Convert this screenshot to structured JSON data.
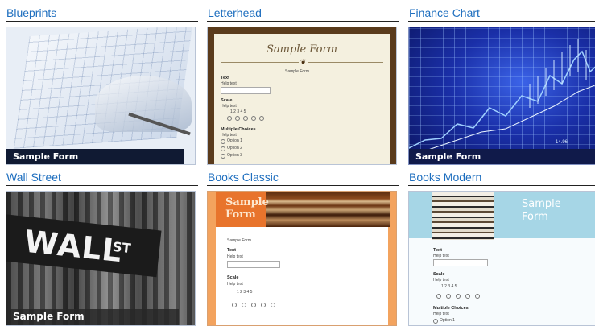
{
  "themes": [
    {
      "name": "Blueprints",
      "caption": "Sample Form"
    },
    {
      "name": "Letterhead",
      "caption": "Sample Form"
    },
    {
      "name": "Finance Chart",
      "caption": "Sample Form"
    },
    {
      "name": "Wall Street",
      "caption": "Sample Form"
    },
    {
      "name": "Books Classic",
      "caption": "Sample Form"
    },
    {
      "name": "Books Modern",
      "caption": "Sample Form"
    }
  ],
  "wall_sign": {
    "main": "WALL",
    "suffix": "ST"
  },
  "finance_value": "14.96",
  "preview_form": {
    "intro": "Sample Form...",
    "field_text": "Text",
    "help": "Help text",
    "field_scale": "Scale",
    "scale_numbers": "1   2   3   4   5",
    "scale_numbers_letterhead": "1   2   3   4   5",
    "field_choices": "Multiple Choices",
    "option1": "Option 1",
    "option2": "Option 2",
    "option3": "Option 3"
  },
  "colors": {
    "link": "#1f6fbf",
    "rule": "#222222"
  }
}
